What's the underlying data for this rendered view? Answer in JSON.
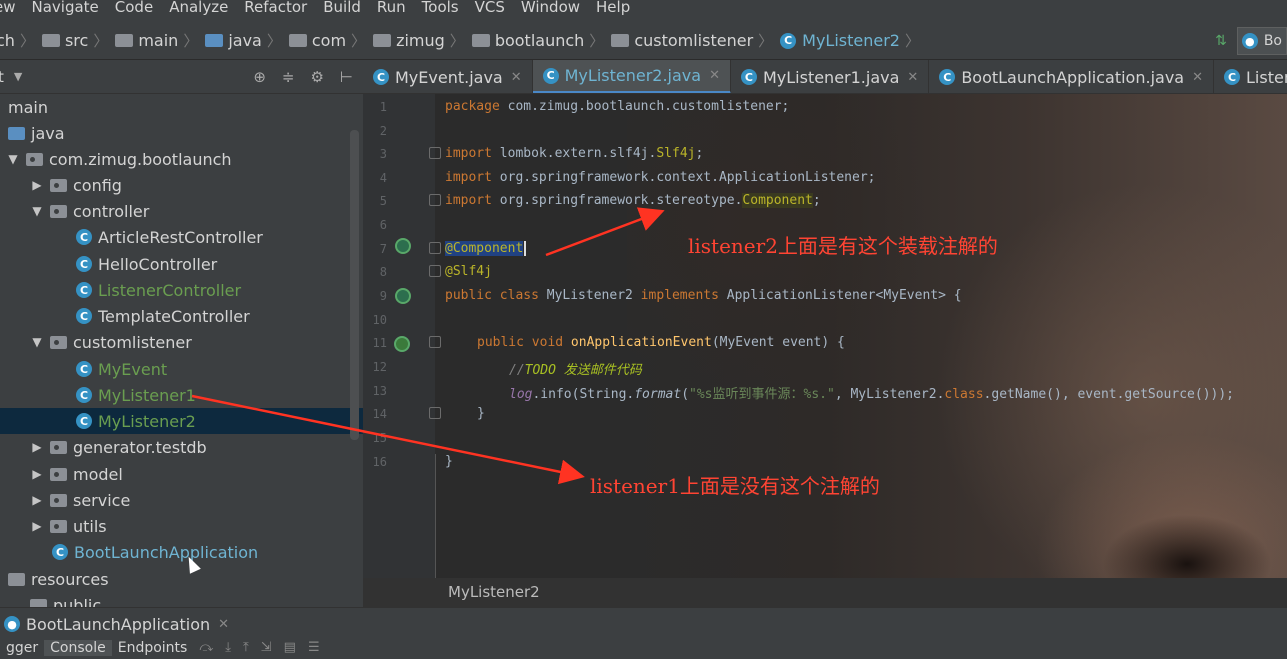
{
  "menu": [
    "ew",
    "Navigate",
    "Code",
    "Analyze",
    "Refactor",
    "Build",
    "Run",
    "Tools",
    "VCS",
    "Window",
    "Help"
  ],
  "navbar": {
    "crumbs": [
      "ch",
      "src",
      "main",
      "java",
      "com",
      "zimug",
      "bootlaunch",
      "customlistener",
      "MyListener2"
    ],
    "run_config": "Bo"
  },
  "project": {
    "title": "t",
    "tree": [
      {
        "label": "main"
      },
      {
        "label": "java"
      },
      {
        "label": "com.zimug.bootlaunch"
      },
      {
        "label": "config"
      },
      {
        "label": "controller"
      },
      {
        "label": "ArticleRestController"
      },
      {
        "label": "HelloController"
      },
      {
        "label": "ListenerController"
      },
      {
        "label": "TemplateController"
      },
      {
        "label": "customlistener"
      },
      {
        "label": "MyEvent"
      },
      {
        "label": "MyListener1"
      },
      {
        "label": "MyListener2"
      },
      {
        "label": "generator.testdb"
      },
      {
        "label": "model"
      },
      {
        "label": "service"
      },
      {
        "label": "utils"
      },
      {
        "label": "BootLaunchApplication"
      },
      {
        "label": "resources"
      },
      {
        "label": "public"
      }
    ]
  },
  "tabs": [
    {
      "label": "MyEvent.java"
    },
    {
      "label": "MyListener2.java"
    },
    {
      "label": "MyListener1.java"
    },
    {
      "label": "BootLaunchApplication.java"
    },
    {
      "label": "ListenerContr"
    }
  ],
  "editor": {
    "line_numbers": [
      "1",
      "2",
      "3",
      "4",
      "5",
      "6",
      "7",
      "8",
      "9",
      "10",
      "11",
      "12",
      "13",
      "14",
      "15",
      "16"
    ],
    "code": {
      "l1_kw": "package",
      "l1_rest": " com.zimug.bootlaunch.customlistener;",
      "l3_kw": "import",
      "l3_rest": " lombok.extern.slf4j.",
      "l3_ann": "Slf4j",
      "l3_end": ";",
      "l4_kw": "import",
      "l4_rest": " org.springframework.context.ApplicationListener;",
      "l5_kw": "import",
      "l5_rest": " org.springframework.stereotype.",
      "l5_ann": "Component",
      "l5_end": ";",
      "l7": "@Component",
      "l8": "@Slf4j",
      "l9_kw": "public class",
      "l9_name": " MyListener2 ",
      "l9_kw2": "implements",
      "l9_rest": " ApplicationListener<MyEvent> {",
      "l11_kw": "public void",
      "l11_fn": " onApplicationEvent",
      "l11_rest": "(MyEvent event) {",
      "l12_c": "//",
      "l12_todo": "TODO",
      "l12_text": " 发送邮件代码",
      "l13_log": "log",
      "l13_a": ".info(String.",
      "l13_fmt": "format",
      "l13_b": "(",
      "l13_str": "\"%s监听到事件源：%s.\"",
      "l13_c": ", MyListener2.",
      "l13_kwc": "class",
      "l13_d": ".getName(), event.getSource()));",
      "l14": "}",
      "l16": "}"
    },
    "annotations": {
      "top": "listener2上面是有这个装载注解的",
      "bottom": "listener1上面是没有这个注解的"
    },
    "breadcrumb": "MyListener2"
  },
  "bottom": {
    "run_tab": "BootLaunchApplication",
    "tools": [
      "gger",
      "Console",
      "Endpoints"
    ]
  },
  "colors": {
    "annotation_red": "#ff4433",
    "selection": "#0d293e",
    "keyword": "#cc7832",
    "annotation": "#bbb529"
  }
}
